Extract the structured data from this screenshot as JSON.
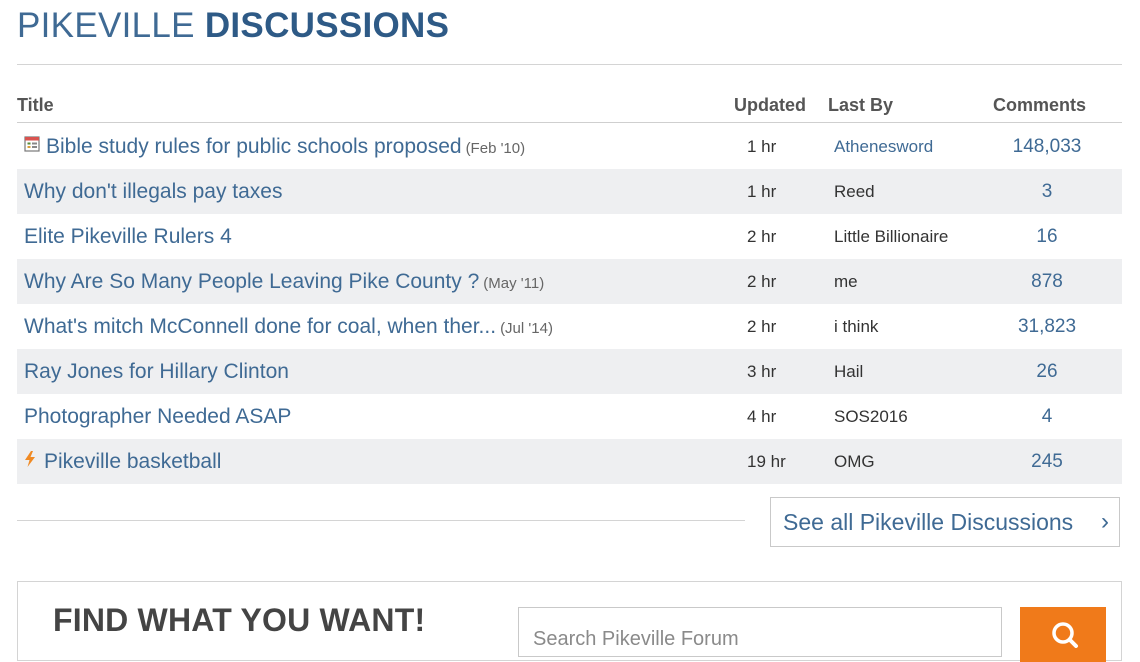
{
  "header": {
    "title_part1": "PIKEVILLE ",
    "title_part2": "DISCUSSIONS"
  },
  "columns": {
    "title": "Title",
    "updated": "Updated",
    "last_by": "Last By",
    "comments": "Comments"
  },
  "threads": [
    {
      "icon": "calendar-icon",
      "title": "Bible study rules for public schools proposed",
      "date": "(Feb '10)",
      "updated": "1 hr",
      "last_by": "Athenesword",
      "comments": "148,033"
    },
    {
      "icon": "",
      "title": "Why don't illegals pay taxes",
      "date": "",
      "updated": "1 hr",
      "last_by": "Reed",
      "comments": "3"
    },
    {
      "icon": "",
      "title": "Elite Pikeville Rulers 4",
      "date": "",
      "updated": "2 hr",
      "last_by": "Little Billionaire",
      "comments": "16"
    },
    {
      "icon": "",
      "title": "Why Are So Many People Leaving Pike County ?",
      "date": "(May '11)",
      "updated": "2 hr",
      "last_by": "me",
      "comments": "878"
    },
    {
      "icon": "",
      "title": "What's mitch McConnell done for coal, when ther...",
      "date": "(Jul '14)",
      "updated": "2 hr",
      "last_by": "i think",
      "comments": "31,823"
    },
    {
      "icon": "",
      "title": "Ray Jones for Hillary Clinton",
      "date": "",
      "updated": "3 hr",
      "last_by": "Hail",
      "comments": "26"
    },
    {
      "icon": "",
      "title": "Photographer Needed ASAP",
      "date": "",
      "updated": "4 hr",
      "last_by": "SOS2016",
      "comments": "4"
    },
    {
      "icon": "lightning-icon",
      "title": "Pikeville basketball",
      "date": "",
      "updated": "19 hr",
      "last_by": "OMG",
      "comments": "245"
    }
  ],
  "see_all": {
    "label": "See all Pikeville Discussions",
    "chevron": "›"
  },
  "find": {
    "title": "FIND WHAT YOU WANT!",
    "placeholder": "Search Pikeville Forum"
  },
  "colors": {
    "accent": "#3f6a94",
    "title_strong": "#2e5a86",
    "search_button": "#f07a1a",
    "row_alt": "#eeeff1"
  }
}
